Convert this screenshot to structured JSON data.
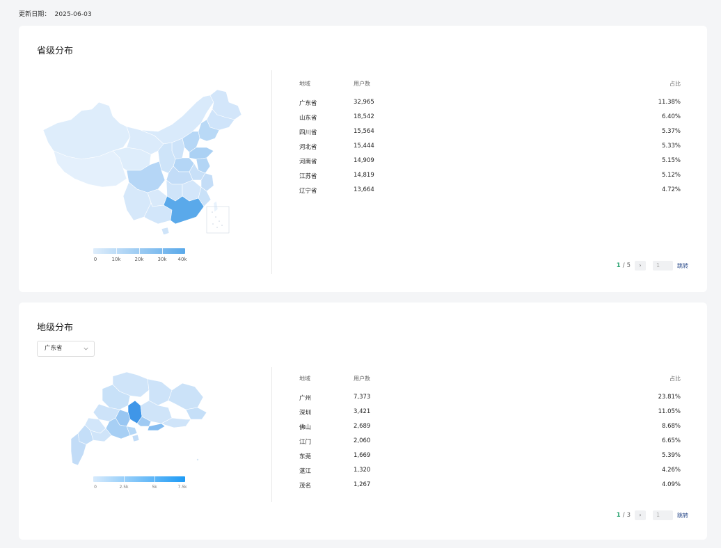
{
  "header": {
    "update_label": "更新日期：",
    "update_date": "2025-06-03"
  },
  "province_section": {
    "title": "省级分布",
    "columns": {
      "region": "地域",
      "users": "用户数",
      "pct": "占比"
    },
    "rows": [
      {
        "region": "广东省",
        "users": "32,965",
        "pct": "11.38%"
      },
      {
        "region": "山东省",
        "users": "18,542",
        "pct": "6.40%"
      },
      {
        "region": "四川省",
        "users": "15,564",
        "pct": "5.37%"
      },
      {
        "region": "河北省",
        "users": "15,444",
        "pct": "5.33%"
      },
      {
        "region": "河南省",
        "users": "14,909",
        "pct": "5.15%"
      },
      {
        "region": "江苏省",
        "users": "14,819",
        "pct": "5.12%"
      },
      {
        "region": "辽宁省",
        "users": "13,664",
        "pct": "4.72%"
      }
    ],
    "legend": {
      "labels": [
        "0",
        "10k",
        "20k",
        "30k",
        "40k"
      ],
      "color_from": "#deedfb",
      "color_to": "#5aa9ea"
    },
    "pager": {
      "current": "1",
      "total": "5",
      "next_symbol": "›",
      "jump_value": "1",
      "jump_label": "跳转"
    }
  },
  "city_section": {
    "title": "地级分布",
    "select_value": "广东省",
    "columns": {
      "region": "地域",
      "users": "用户数",
      "pct": "占比"
    },
    "rows": [
      {
        "region": "广州",
        "users": "7,373",
        "pct": "23.81%"
      },
      {
        "region": "深圳",
        "users": "3,421",
        "pct": "11.05%"
      },
      {
        "region": "佛山",
        "users": "2,689",
        "pct": "8.68%"
      },
      {
        "region": "江门",
        "users": "2,060",
        "pct": "6.65%"
      },
      {
        "region": "东莞",
        "users": "1,669",
        "pct": "5.39%"
      },
      {
        "region": "湛江",
        "users": "1,320",
        "pct": "4.26%"
      },
      {
        "region": "茂名",
        "users": "1,267",
        "pct": "4.09%"
      }
    ],
    "legend": {
      "labels": [
        "0",
        "2.5k",
        "5k",
        "7.5k"
      ],
      "color_from": "#d7eafc",
      "color_to": "#1e9bf5"
    },
    "pager": {
      "current": "1",
      "total": "3",
      "next_symbol": "›",
      "jump_value": "1",
      "jump_label": "跳转"
    }
  }
}
